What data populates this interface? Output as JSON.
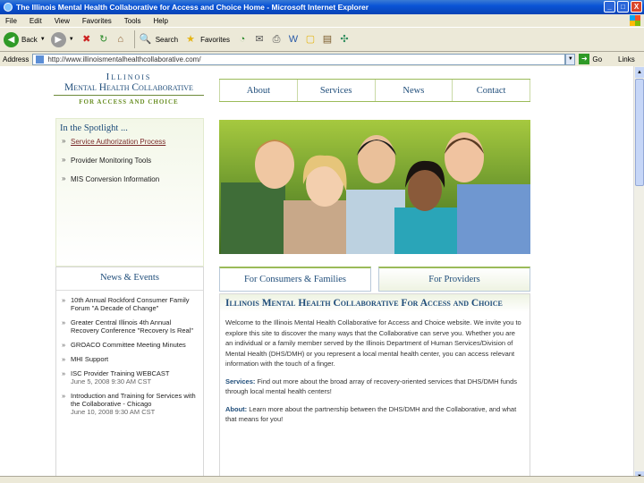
{
  "window": {
    "title": "The Illinois Mental Health Collaborative for Access and Choice Home - Microsoft Internet Explorer",
    "buttons": [
      "_",
      "□",
      "X"
    ]
  },
  "menu": [
    "File",
    "Edit",
    "View",
    "Favorites",
    "Tools",
    "Help"
  ],
  "toolbar": {
    "back_label": "Back",
    "search_label": "Search",
    "favorites_label": "Favorites"
  },
  "address": {
    "label": "Address",
    "url": "http://www.illinoismentalhealthcollaborative.com/",
    "go_label": "Go",
    "links_label": "Links"
  },
  "logo": {
    "line1": "Illinois",
    "line2": "Mental Health Collaborative",
    "line3": "FOR ACCESS AND CHOICE"
  },
  "nav": [
    "About",
    "Services",
    "News",
    "Contact"
  ],
  "spotlight": {
    "title": "In the Spotlight ...",
    "items": [
      "Service Authorization Process",
      "Provider Monitoring Tools",
      "MIS Conversion Information"
    ]
  },
  "news": {
    "title": "News & Events",
    "items": [
      {
        "text": "10th Annual Rockford Consumer Family Forum \"A Decade of Change\"",
        "date": ""
      },
      {
        "text": "Greater Central Illinois 4th Annual Recovery Conference \"Recovery Is Real\"",
        "date": ""
      },
      {
        "text": "GROACO Committee Meeting Minutes",
        "date": ""
      },
      {
        "text": "MHI Support",
        "date": ""
      },
      {
        "text": "ISC Provider Training WEBCAST",
        "date": "June 5, 2008 9:30 AM CST"
      },
      {
        "text": "Introduction and Training for Services with the Collaborative - Chicago",
        "date": "June 10, 2008 9:30 AM CST"
      }
    ]
  },
  "tabs": [
    "For Consumers & Families",
    "For Providers"
  ],
  "content": {
    "heading": "Illinois Mental Health Collaborative For Access and Choice",
    "intro": "Welcome to the Illinois Mental Health Collaborative for Access and Choice website. We invite you to explore this site to discover the many ways that the Collaborative can serve you. Whether you are an individual or a family member served by the Illinois Department of Human Services/Division of Mental Health (DHS/DMH) or you represent a local mental health center, you can access relevant information with the touch of a finger.",
    "services_label": "Services:",
    "services_text": "Find out more about the broad array of recovery-oriented services that DHS/DMH funds through local mental health centers!",
    "about_label": "About:",
    "about_text": "Learn more about the partnership between the DHS/DMH and the Collaborative, and what that means for you!"
  },
  "colors": {
    "brand_blue": "#1f4d7a",
    "accent_green": "#9bbb59",
    "xp_title": "#0a54d6"
  }
}
